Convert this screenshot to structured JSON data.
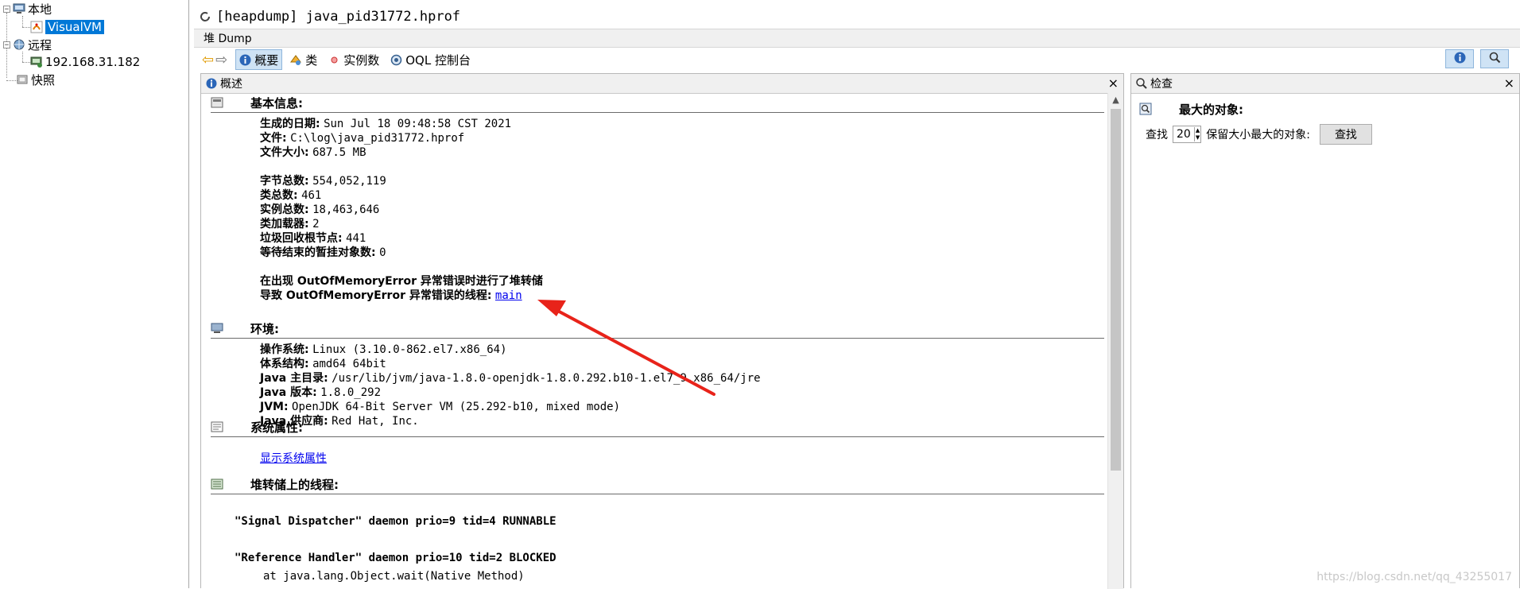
{
  "tree": {
    "local": "本地",
    "visualvm": "VisualVM",
    "remote": "远程",
    "host": "192.168.31.182",
    "snapshots": "快照"
  },
  "document": {
    "title": "[heapdump] java_pid31772.hprof",
    "subtab": "堆 Dump"
  },
  "toolbar": {
    "summary": "概要",
    "classes": "类",
    "instances": "实例数",
    "oql": "OQL 控制台"
  },
  "overview": {
    "title": "概述",
    "basic": {
      "title": "基本信息:",
      "rows": [
        {
          "label": "生成的日期:",
          "value": "Sun Jul 18 09:48:58 CST 2021"
        },
        {
          "label": "文件:",
          "value": "C:\\log\\java_pid31772.hprof"
        },
        {
          "label": "文件大小:",
          "value": "687.5 MB"
        },
        {
          "label": "字节总数:",
          "value": "554,052,119"
        },
        {
          "label": "类总数:",
          "value": "461"
        },
        {
          "label": "实例总数:",
          "value": "18,463,646"
        },
        {
          "label": "类加载器:",
          "value": "2"
        },
        {
          "label": "垃圾回收根节点:",
          "value": "441"
        },
        {
          "label": "等待结束的暂挂对象数:",
          "value": "0"
        }
      ],
      "oom_note": "在出现 OutOfMemoryError 异常错误时进行了堆转储",
      "oom_thread_label": "导致 OutOfMemoryError 异常错误的线程:",
      "oom_thread_link": "main"
    },
    "env": {
      "title": "环境:",
      "rows": [
        {
          "label": "操作系统:",
          "value": "Linux (3.10.0-862.el7.x86_64)"
        },
        {
          "label": "体系结构:",
          "value": "amd64 64bit"
        },
        {
          "label": "Java 主目录:",
          "value": "/usr/lib/jvm/java-1.8.0-openjdk-1.8.0.292.b10-1.el7_9.x86_64/jre"
        },
        {
          "label": "Java 版本:",
          "value": "1.8.0_292"
        },
        {
          "label": "JVM:",
          "value": "OpenJDK 64-Bit Server VM (25.292-b10, mixed mode)"
        },
        {
          "label": "Java 供应商:",
          "value": "Red Hat, Inc."
        }
      ]
    },
    "sysprops": {
      "title": "系统属性:",
      "link": "显示系统属性"
    },
    "threads": {
      "title": "堆转储上的线程:",
      "items": [
        "\"Signal Dispatcher\" daemon prio=9 tid=4 RUNNABLE",
        "\"Reference Handler\" daemon prio=10 tid=2 BLOCKED"
      ],
      "frame": "at java.lang.Object.wait(Native Method)"
    }
  },
  "inspect": {
    "title": "检查",
    "section": "最大的对象:",
    "find_label": "查找",
    "count": "20",
    "retained_label": "保留大小最大的对象:",
    "find_button": "查找"
  },
  "watermark": "https://blog.csdn.net/qq_43255017",
  "colors": {
    "selection": "#0078d7",
    "link": "#0000ee",
    "annotation_arrow": "#e8231a"
  }
}
